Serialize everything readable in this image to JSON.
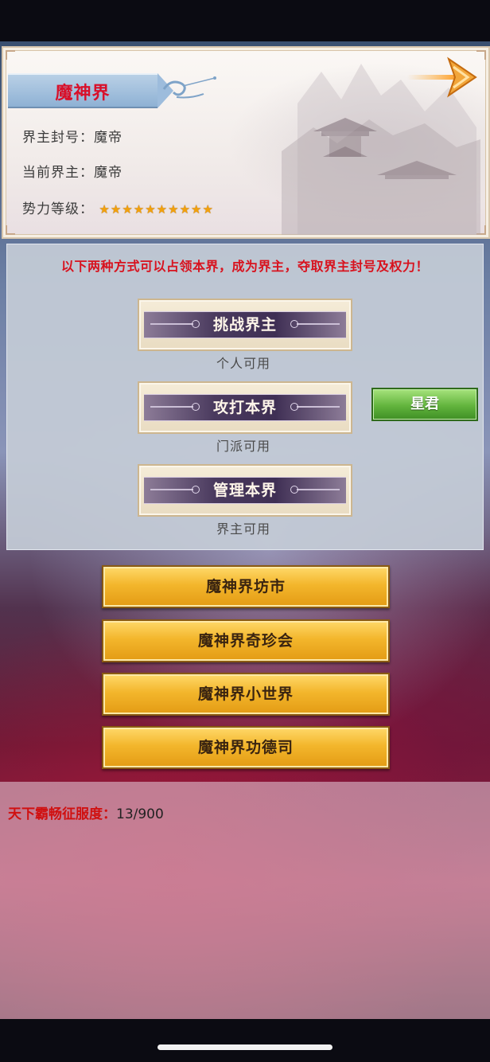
{
  "realm": {
    "name": "魔神界",
    "rows": [
      {
        "label": "界主封号：",
        "value": "魔帝"
      },
      {
        "label": "当前界主：",
        "value": "魔帝"
      },
      {
        "label": "势力等级：",
        "value": ""
      }
    ],
    "power_level_stars": 10,
    "star_icon": "star-icon"
  },
  "notice": "以下两种方式可以占领本界，成为界主，夺取界主封号及权力！",
  "actions": [
    {
      "label": "挑战界主",
      "sub": "个人可用"
    },
    {
      "label": "攻打本界",
      "sub": "门派可用"
    },
    {
      "label": "管理本界",
      "sub": "界主可用"
    }
  ],
  "rank_button": "星君",
  "menu_buttons": [
    "魔神界坊市",
    "魔神界奇珍会",
    "魔神界小世界",
    "魔神界功德司"
  ],
  "conquest": {
    "label": "天下霸畅征服度：",
    "value": "13/900"
  },
  "colors": {
    "title_red": "#d8121e",
    "gold": "#f3b62c",
    "green": "#62b43d"
  }
}
